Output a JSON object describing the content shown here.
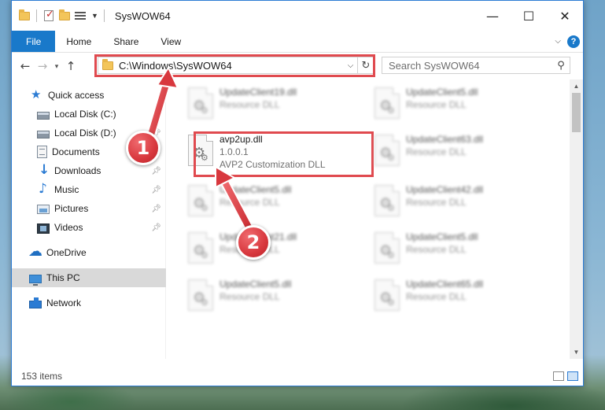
{
  "window": {
    "title": "SysWOW64",
    "controls": {
      "minimize": "—",
      "maximize": "☐",
      "close": "✕"
    }
  },
  "ribbon": {
    "tabs": [
      {
        "label": "File",
        "active": true
      },
      {
        "label": "Home"
      },
      {
        "label": "Share"
      },
      {
        "label": "View"
      }
    ],
    "help": "?"
  },
  "nav": {
    "back": "←",
    "forward": "→",
    "recent": "▾",
    "up": "↑",
    "address": "C:\\Windows\\SysWOW64",
    "address_dropdown": "⌵",
    "refresh": "↻",
    "search_placeholder": "Search SysWOW64",
    "search_icon": "⚲"
  },
  "sidebar": {
    "items": [
      {
        "label": "Quick access",
        "icon": "star-icon"
      },
      {
        "label": "Local Disk (C:)",
        "icon": "disk-icon",
        "pinned": true
      },
      {
        "label": "Local Disk (D:)",
        "icon": "disk-icon",
        "pinned": true
      },
      {
        "label": "Documents",
        "icon": "documents-icon",
        "pinned": true
      },
      {
        "label": "Downloads",
        "icon": "download-icon",
        "pinned": true
      },
      {
        "label": "Music",
        "icon": "music-icon",
        "pinned": true
      },
      {
        "label": "Pictures",
        "icon": "pictures-icon",
        "pinned": true
      },
      {
        "label": "Videos",
        "icon": "videos-icon",
        "pinned": true
      },
      {
        "label": "OneDrive",
        "icon": "cloud-icon"
      },
      {
        "label": "This PC",
        "icon": "pc-icon",
        "selected": true
      },
      {
        "label": "Network",
        "icon": "network-icon"
      }
    ]
  },
  "files": [
    {
      "name": "UpdateClient19.dll",
      "sub": "Resource DLL"
    },
    {
      "name": "UpdateClient5.dll",
      "sub": "Resource DLL"
    },
    {
      "name": "avp2up.dll",
      "version": "1.0.0.1",
      "sub": "AVP2 Customization DLL",
      "highlighted": true
    },
    {
      "name": "UpdateClient63.dll",
      "sub": "Resource DLL"
    },
    {
      "name": "UpdateClient5.dll",
      "sub": "Resource DLL"
    },
    {
      "name": "UpdateClient42.dll",
      "sub": "Resource DLL"
    },
    {
      "name": "UpdateClient21.dll",
      "sub": "Resource DLL"
    },
    {
      "name": "UpdateClient5.dll",
      "sub": "Resource DLL"
    },
    {
      "name": "UpdateClient5.dll",
      "sub": "Resource DLL"
    },
    {
      "name": "UpdateClient65.dll",
      "sub": "Resource DLL"
    }
  ],
  "status": {
    "items": "153 items"
  },
  "callouts": [
    "1",
    "2"
  ],
  "colors": {
    "accent": "#1979ca",
    "highlight_box": "#e04a4f"
  }
}
